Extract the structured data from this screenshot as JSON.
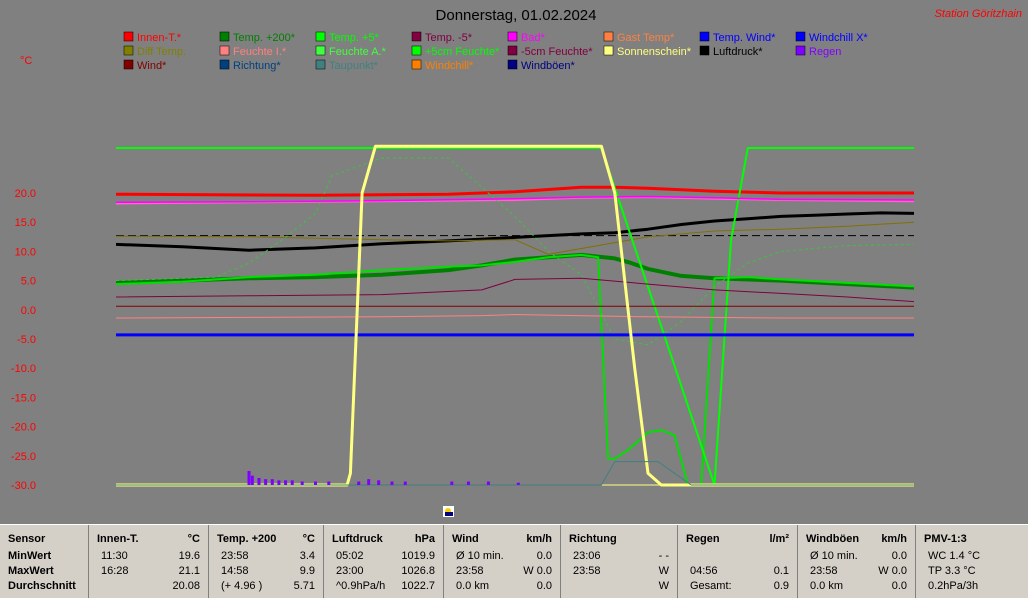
{
  "header": {
    "title": "Donnerstag, 01.02.2024",
    "station": "Station Göritzhain",
    "unit": "°C"
  },
  "legend": [
    {
      "label": "Innen-T.*",
      "color": "#ff0000"
    },
    {
      "label": "Temp. +200*",
      "color": "#008000"
    },
    {
      "label": "Temp. +5*",
      "color": "#00ff00"
    },
    {
      "label": "Temp. -5*",
      "color": "#800040"
    },
    {
      "label": "Bad*",
      "color": "#ff00ff"
    },
    {
      "label": "Gast Temp*",
      "color": "#ff8040"
    },
    {
      "label": "Temp. Wind*",
      "color": "#0000ff"
    },
    {
      "label": "Windchill X*",
      "color": "#0000ff"
    },
    {
      "label": "Diff Temp.",
      "color": "#808000"
    },
    {
      "label": "Feuchte I.*",
      "color": "#ff8080"
    },
    {
      "label": "Feuchte A.*",
      "color": "#40ff40"
    },
    {
      "label": "+5cm Feuchte*",
      "color": "#00ff00"
    },
    {
      "label": "-5cm Feuchte*",
      "color": "#800040"
    },
    {
      "label": "Sonnenschein*",
      "color": "#ffff80"
    },
    {
      "label": "Luftdruck*",
      "color": "#000000"
    },
    {
      "label": "Regen",
      "color": "#8000ff"
    },
    {
      "label": "Wind*",
      "color": "#800000"
    },
    {
      "label": "Richtung*",
      "color": "#004080"
    },
    {
      "label": "Taupunkt*",
      "color": "#408080"
    },
    {
      "label": "Windchill*",
      "color": "#ff8000"
    },
    {
      "label": "Windböen*",
      "color": "#000080"
    }
  ],
  "chart_data": {
    "type": "line",
    "title": "Donnerstag, 01.02.2024",
    "ylabel": "°C",
    "ylim": [
      -30,
      25
    ],
    "xlim": [
      0,
      24
    ],
    "yticks": [
      "20.0",
      "15.0",
      "10.0",
      "5.0",
      "0.0",
      "-5.0",
      "-10.0",
      "-15.0",
      "-20.0",
      "-25.0",
      "-30.0"
    ],
    "series": [
      {
        "name": "Innen-T.*",
        "color": "#ff0000",
        "x": [
          0,
          6,
          10,
          12,
          13,
          14,
          15,
          16,
          18,
          20,
          22,
          24
        ],
        "y": [
          19.8,
          19.6,
          19.8,
          20.2,
          20.6,
          21.0,
          21.0,
          20.8,
          20.3,
          20.0,
          20.0,
          20.0
        ]
      },
      {
        "name": "Feuchte I.*",
        "color": "#ff66cc",
        "x": [
          0,
          4,
          8,
          12,
          14,
          16,
          18,
          20,
          22,
          24
        ],
        "y": [
          18.2,
          18.4,
          18.6,
          18.8,
          19.2,
          19.3,
          19.0,
          18.8,
          18.7,
          18.6
        ]
      },
      {
        "name": "Luftdruck*",
        "color": "#000000",
        "x": [
          0,
          2,
          4,
          6,
          8,
          10,
          12,
          14,
          15,
          16,
          17,
          18,
          19,
          20,
          21,
          22,
          23,
          24
        ],
        "y": [
          11.2,
          10.8,
          10.2,
          10.6,
          11.3,
          11.8,
          12.4,
          13.0,
          13.2,
          13.8,
          14.6,
          15.2,
          15.6,
          16.0,
          16.2,
          16.4,
          16.6,
          16.5
        ]
      },
      {
        "name": "Diff Temp.",
        "color": "#807000",
        "x": [
          0,
          4,
          8,
          10,
          12,
          13,
          14,
          16,
          18,
          20,
          22,
          24
        ],
        "y": [
          12.6,
          12.5,
          12.0,
          11.8,
          12.0,
          9.5,
          10.5,
          12.5,
          13.5,
          13.8,
          14.3,
          15.0
        ]
      },
      {
        "name": "Temp. +200*",
        "color": "#008000",
        "x": [
          0,
          2,
          4,
          6,
          8,
          10,
          11,
          12,
          13,
          14,
          15,
          15.5,
          16,
          17,
          18,
          20,
          22,
          24
        ],
        "y": [
          4.6,
          5.0,
          5.4,
          5.6,
          6.0,
          6.8,
          7.6,
          8.6,
          9.0,
          9.4,
          8.8,
          8.0,
          7.0,
          5.8,
          5.4,
          5.0,
          4.4,
          3.8
        ]
      },
      {
        "name": "Temp. +5*",
        "color": "#00e000",
        "x": [
          0,
          2,
          4,
          6,
          8,
          10,
          11,
          12,
          13,
          14,
          14.5,
          14.8,
          15.0,
          15.4,
          16,
          16.4,
          16.8,
          17.2,
          17.6,
          18,
          19,
          20,
          22,
          24
        ],
        "y": [
          4.4,
          4.8,
          5.6,
          6.0,
          6.8,
          7.4,
          7.6,
          8.2,
          9.0,
          9.4,
          9.0,
          -25.5,
          -25.5,
          -24,
          -21,
          -20.6,
          -21.5,
          -30,
          -30,
          5.4,
          5.6,
          5.2,
          4.6,
          4.0
        ]
      },
      {
        "name": "Feuchte A.*",
        "color": "#00ff00",
        "x": [
          0,
          14.4,
          14.6,
          18.0,
          18.5,
          19,
          24
        ],
        "y": [
          27.7,
          27.7,
          27.7,
          -30,
          12,
          27.7,
          27.7
        ]
      },
      {
        "name": "+5cm Feuchte*",
        "color": "#40c040",
        "x": [
          0,
          3,
          4,
          5,
          6,
          6.5,
          8,
          9,
          10,
          12,
          13,
          14,
          15,
          16,
          17,
          18,
          19,
          20,
          22,
          24
        ],
        "y": [
          5.0,
          5.6,
          8.0,
          12.0,
          16.5,
          23,
          26,
          26,
          26,
          16,
          10,
          6,
          -5,
          -6,
          -2,
          4,
          8,
          10,
          11,
          11.2
        ]
      },
      {
        "name": "Temp. -5*",
        "color": "#800040",
        "x": [
          0,
          4,
          8,
          11,
          12,
          14,
          16,
          18,
          20,
          22,
          24
        ],
        "y": [
          2.2,
          2.4,
          2.6,
          3.4,
          5.2,
          5.4,
          4.4,
          3.4,
          2.8,
          2.2,
          1.4
        ]
      },
      {
        "name": "Bad*",
        "color": "#ff00ff",
        "x": [
          0,
          4,
          8,
          12,
          14,
          16,
          18,
          20,
          24
        ],
        "y": [
          18.4,
          18.5,
          18.7,
          19.0,
          19.3,
          19.4,
          19.2,
          18.9,
          18.8
        ]
      },
      {
        "name": "Wind*",
        "color": "#800000",
        "x": [
          0,
          24
        ],
        "y": [
          0.6,
          0.6
        ]
      },
      {
        "name": "Gast Temp*",
        "color": "#ff8080",
        "x": [
          0,
          4,
          8,
          11,
          12,
          13,
          16,
          20,
          24
        ],
        "y": [
          -1.4,
          -1.3,
          -1.2,
          -1.0,
          -0.8,
          -0.9,
          -1.2,
          -1.4,
          -1.4
        ]
      },
      {
        "name": "Temp. Wind*",
        "color": "#0000ff",
        "x": [
          0,
          24
        ],
        "y": [
          -4.3,
          -4.3
        ]
      },
      {
        "name": "Sonnenschein*",
        "color": "#ffff80",
        "x": [
          0,
          6.95,
          7.05,
          7.4,
          7.8,
          14.4,
          14.6,
          15.0,
          15.6,
          16.0,
          16.4,
          17,
          24
        ],
        "y": [
          -30,
          -30,
          -28,
          20,
          28,
          28,
          28,
          20,
          -10,
          -28,
          -30,
          -30,
          -30
        ]
      },
      {
        "name": "Taupunkt*",
        "color": "#408080",
        "x": [
          0,
          14.4,
          14.6,
          15.0,
          16.3,
          16.8,
          17.3,
          17.8,
          18.0,
          24
        ],
        "y": [
          -30,
          -30,
          -30,
          -26,
          -26,
          -28,
          -30,
          -30,
          -30,
          -30
        ]
      }
    ],
    "reference_line": {
      "y": 12.7
    },
    "rain_bars": {
      "x": [
        4.0,
        4.1,
        4.3,
        4.5,
        4.7,
        4.9,
        5.1,
        5.3,
        5.6,
        6.0,
        6.4,
        7.3,
        7.6,
        7.9,
        8.3,
        8.7,
        10.1,
        10.6,
        11.2,
        12.1
      ],
      "y": [
        2.4,
        1.6,
        1.2,
        1.0,
        1.0,
        0.8,
        0.8,
        0.8,
        0.6,
        0.6,
        0.6,
        0.6,
        1.0,
        0.8,
        0.6,
        0.6,
        0.6,
        0.6,
        0.6,
        0.4
      ]
    }
  },
  "stats": {
    "cols": [
      {
        "h1": "Sensor",
        "r1a": "MinWert",
        "r2a": "MaxWert",
        "r3a": "Durchschnitt"
      },
      {
        "h1": "Innen-T.",
        "h2": "°C",
        "r1a": "11:30",
        "r1b": "19.6",
        "r2a": "16:28",
        "r2b": "21.1",
        "r3a": "",
        "r3b": "20.08"
      },
      {
        "h1": "Temp. +200",
        "h2": "°C",
        "r1a": "23:58",
        "r1b": "3.4",
        "r2a": "14:58",
        "r2b": "9.9",
        "r3a": "(+ 4.96 )",
        "r3b": "5.71"
      },
      {
        "h1": "Luftdruck",
        "h2": "hPa",
        "r1a": "05:02",
        "r1b": "1019.9",
        "r2a": "23:00",
        "r2b": "1026.8",
        "r3a": "^0.9hPa/h",
        "r3b": "1022.7"
      },
      {
        "h1": "Wind",
        "h2": "km/h",
        "r1a": "Ø 10 min.",
        "r1b": "0.0",
        "r2a": "23:58",
        "r2b": "W 0.0",
        "r3a": "0.0 km",
        "r3b": "0.0"
      },
      {
        "h1": "Richtung",
        "h2": "",
        "r1a": "23:06",
        "r1b": "- -",
        "r2a": "23:58",
        "r2b": "W",
        "r3a": "",
        "r3b": "W"
      },
      {
        "h1": "Regen",
        "h2": "l/m²",
        "r1a": "",
        "r1b": "",
        "r2a": "04:56",
        "r2b": "0.1",
        "r3a": "Gesamt:",
        "r3b": "0.9"
      },
      {
        "h1": "Windböen",
        "h2": "km/h",
        "r1a": "Ø 10 min.",
        "r1b": "0.0",
        "r2a": "23:58",
        "r2b": "W 0.0",
        "r3a": "0.0 km",
        "r3b": "0.0"
      },
      {
        "h1": "PMV-1:3",
        "h2": "",
        "r1a": "WC 1.4 °C",
        "r1b": "",
        "r2a": "TP 3.3 °C",
        "r2b": "",
        "r3a": "0.2hPa/3h",
        "r3b": ""
      }
    ]
  },
  "colors": {
    "background": "#808080",
    "panel": "#d4d0c8"
  }
}
